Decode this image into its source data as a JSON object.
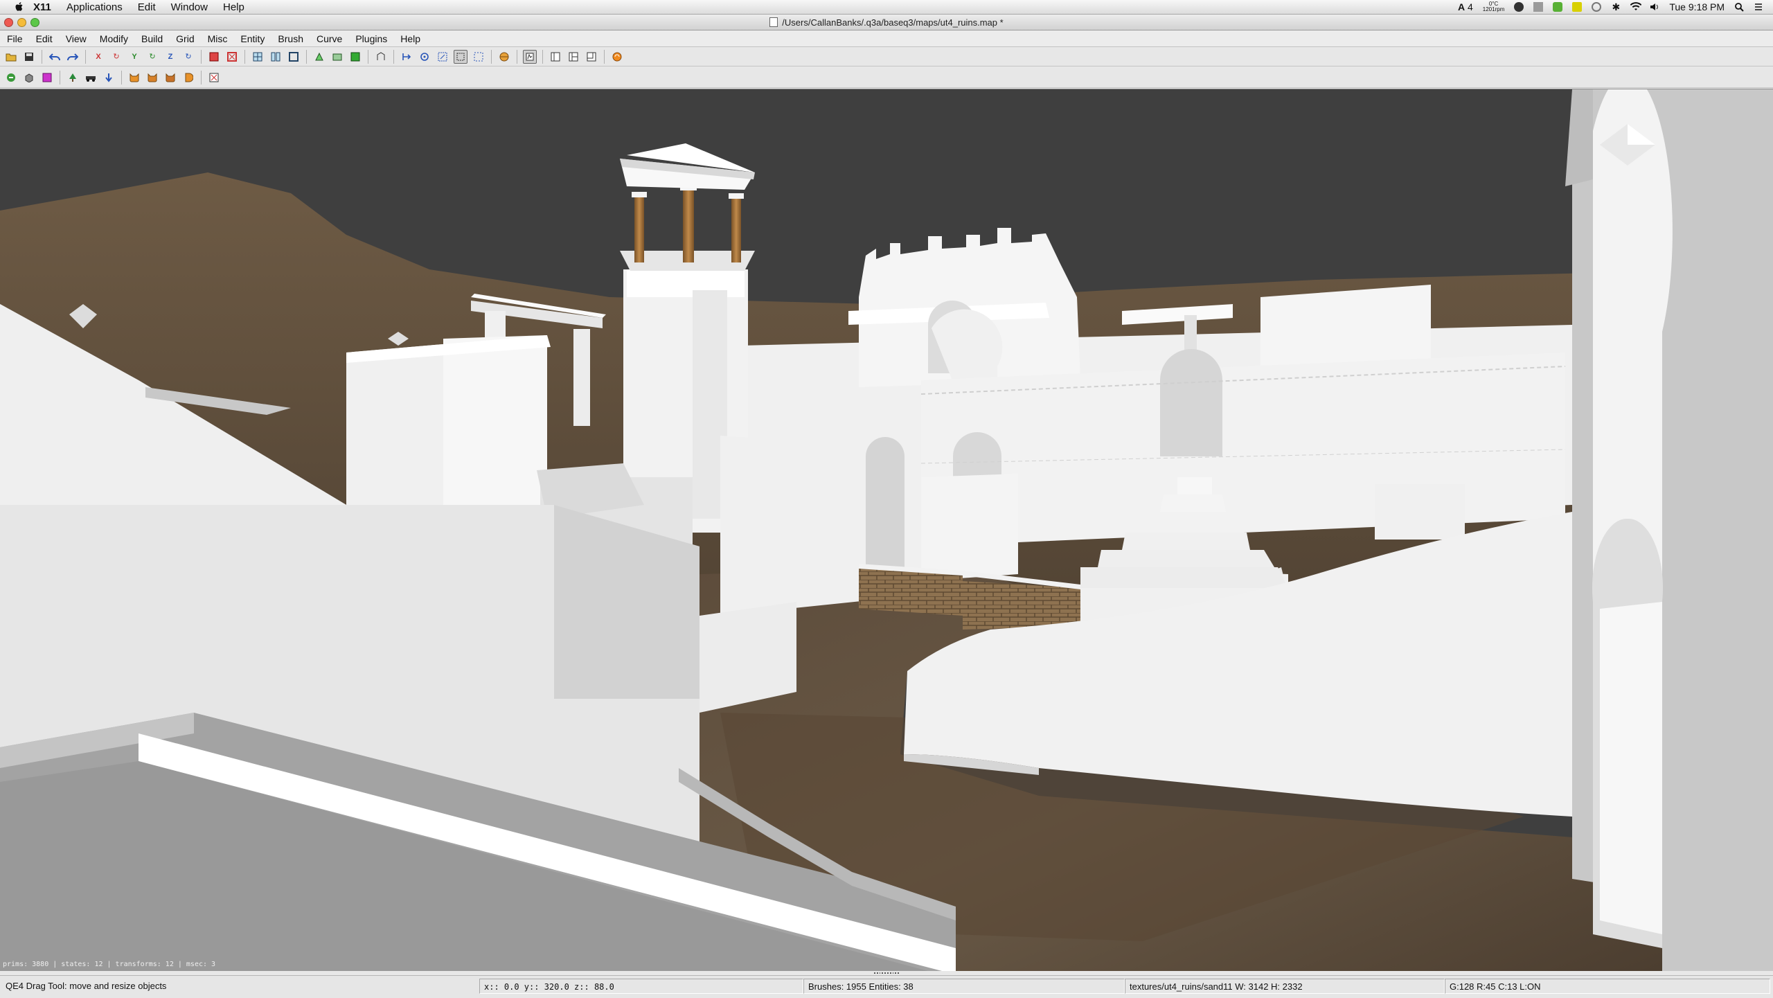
{
  "macos_menubar": {
    "app_name": "X11",
    "items": [
      "Applications",
      "Edit",
      "Window",
      "Help"
    ],
    "status": {
      "adobe_count": "4",
      "temperature": "0°C",
      "fan_speed": "1201rpm",
      "clock": "Tue 9:18 PM"
    }
  },
  "window": {
    "title": "/Users/CallanBanks/.q3a/baseq3/maps/ut4_ruins.map *"
  },
  "menu": {
    "items": [
      "File",
      "Edit",
      "View",
      "Modify",
      "Build",
      "Grid",
      "Misc",
      "Entity",
      "Brush",
      "Curve",
      "Plugins",
      "Help"
    ]
  },
  "toolbar1": {
    "buttons": [
      {
        "icon": "open-file-icon"
      },
      {
        "icon": "save-file-icon"
      },
      {
        "icon": "undo-icon"
      },
      {
        "icon": "redo-icon"
      },
      {
        "icon": "flip-x-icon"
      },
      {
        "icon": "rotate-x-icon"
      },
      {
        "icon": "flip-y-icon"
      },
      {
        "icon": "rotate-y-icon"
      },
      {
        "icon": "flip-z-icon"
      },
      {
        "icon": "rotate-z-icon"
      },
      {
        "icon": "select-complete-tall-icon"
      },
      {
        "icon": "select-touching-icon"
      },
      {
        "icon": "csg-subtract-icon"
      },
      {
        "icon": "csg-merge-icon"
      },
      {
        "icon": "make-hollow-icon"
      },
      {
        "icon": "clipper-icon"
      },
      {
        "icon": "change-view-icon"
      },
      {
        "icon": "texture-view-icon"
      },
      {
        "icon": "cube-clip-icon"
      },
      {
        "icon": "camera-move-icon"
      },
      {
        "icon": "entity-view-icon"
      },
      {
        "icon": "select-drag-icon"
      },
      {
        "icon": "resize-drag-icon"
      },
      {
        "icon": "patch-texture-icon"
      },
      {
        "icon": "drag-tool-icon",
        "active": true
      },
      {
        "icon": "layout-1-icon"
      },
      {
        "icon": "layout-2-icon"
      },
      {
        "icon": "layout-3-icon"
      },
      {
        "icon": "refresh-icon"
      }
    ]
  },
  "toolbar2": {
    "buttons": [
      {
        "icon": "region-icon"
      },
      {
        "icon": "brush-icon"
      },
      {
        "icon": "texture-browser-icon"
      },
      {
        "icon": "tree-icon"
      },
      {
        "icon": "vehicle-icon"
      },
      {
        "icon": "arrow-down-icon"
      },
      {
        "icon": "cat-1-icon"
      },
      {
        "icon": "cat-2-icon"
      },
      {
        "icon": "cat-3-icon"
      },
      {
        "icon": "cat-4-icon"
      },
      {
        "icon": "close-box-icon"
      }
    ]
  },
  "viewport": {
    "stats": "prims: 3880 | states: 12 | transforms: 12 | msec: 3"
  },
  "statusbar": {
    "hint": "QE4 Drag Tool: move and resize objects",
    "coords": "x::    0.0  y::  320.0  z::    88.0",
    "counts": "Brushes: 1955 Entities: 38",
    "texture": "textures/ut4_ruins/sand11 W: 3142 H: 2332",
    "grid": "G:128  R:45  C:13  L:ON"
  },
  "colors": {
    "sky": "#3f3f3f",
    "terrain": "#6b5a44",
    "stone": "#f3f3f3",
    "wood": "#a4733c"
  }
}
